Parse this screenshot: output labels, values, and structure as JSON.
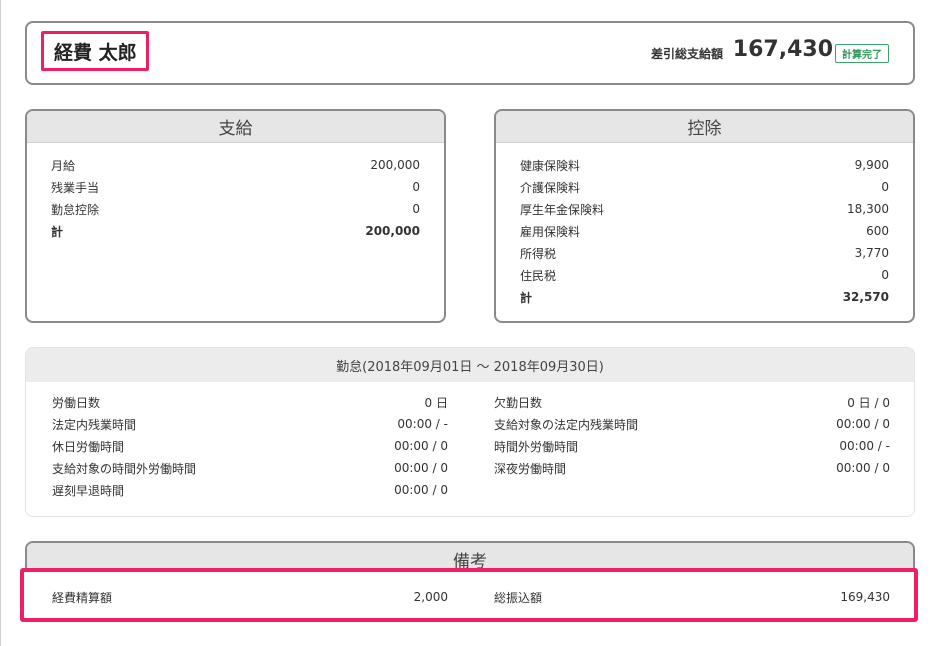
{
  "header": {
    "employee_name": "経費 太郎",
    "net_label": "差引総支給額",
    "net_amount": "167,430",
    "status": "計算完了"
  },
  "payments": {
    "title": "支給",
    "rows": [
      {
        "label": "月給",
        "value": "200,000"
      },
      {
        "label": "残業手当",
        "value": "0"
      },
      {
        "label": "勤怠控除",
        "value": "0"
      }
    ],
    "total": {
      "label": "計",
      "value": "200,000"
    }
  },
  "deductions": {
    "title": "控除",
    "rows": [
      {
        "label": "健康保険料",
        "value": "9,900"
      },
      {
        "label": "介護保険料",
        "value": "0"
      },
      {
        "label": "厚生年金保険料",
        "value": "18,300"
      },
      {
        "label": "雇用保険料",
        "value": "600"
      },
      {
        "label": "所得税",
        "value": "3,770"
      },
      {
        "label": "住民税",
        "value": "0"
      }
    ],
    "total": {
      "label": "計",
      "value": "32,570"
    }
  },
  "attendance": {
    "title": "勤怠(2018年09月01日 〜 2018年09月30日)",
    "left": [
      {
        "label": "労働日数",
        "value": "0 日"
      },
      {
        "label": "法定内残業時間",
        "value": "00:00 / -"
      },
      {
        "label": "休日労働時間",
        "value": "00:00 / 0"
      },
      {
        "label": "支給対象の時間外労働時間",
        "value": "00:00 / 0"
      },
      {
        "label": "遅刻早退時間",
        "value": "00:00 / 0"
      }
    ],
    "right": [
      {
        "label": "欠勤日数",
        "value": "0 日 / 0"
      },
      {
        "label": "支給対象の法定内残業時間",
        "value": "00:00 / 0"
      },
      {
        "label": "時間外労働時間",
        "value": "00:00 / -"
      },
      {
        "label": "深夜労働時間",
        "value": "00:00 / 0"
      }
    ]
  },
  "notes": {
    "title": "備考",
    "expense_label": "経費精算額",
    "expense_value": "2,000",
    "transfer_label": "総振込額",
    "transfer_value": "169,430"
  },
  "colors": {
    "highlight": "#ee1f63",
    "status_green": "#2e9a5e"
  }
}
